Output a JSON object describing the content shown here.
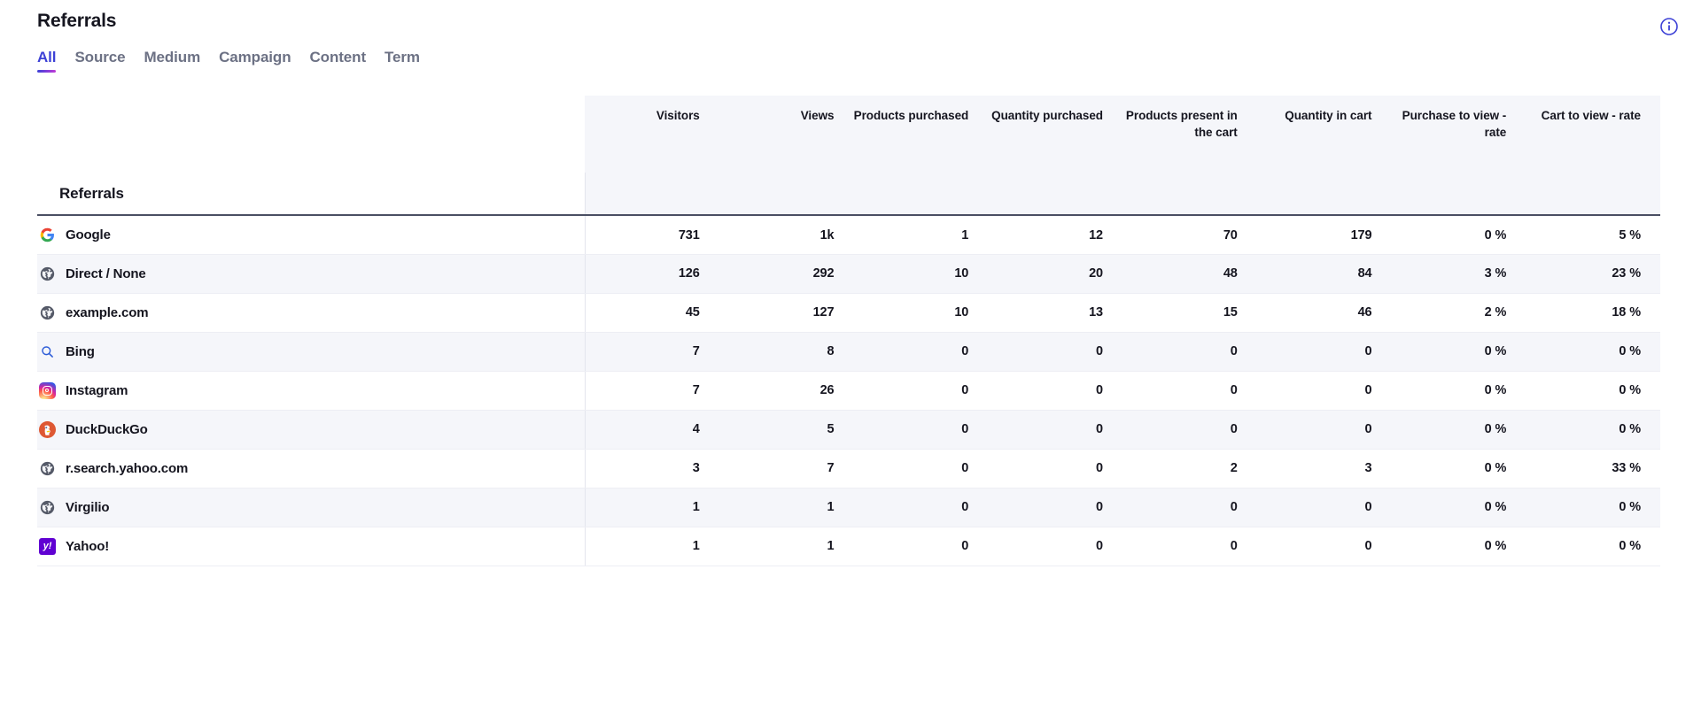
{
  "header": {
    "title": "Referrals",
    "info_icon": "info-circle-icon"
  },
  "tabs": [
    {
      "label": "All",
      "active": true
    },
    {
      "label": "Source",
      "active": false
    },
    {
      "label": "Medium",
      "active": false
    },
    {
      "label": "Campaign",
      "active": false
    },
    {
      "label": "Content",
      "active": false
    },
    {
      "label": "Term",
      "active": false
    }
  ],
  "table": {
    "label_column_header": "",
    "columns": [
      "Visitors",
      "Views",
      "Products purchased",
      "Quantity purchased",
      "Products present in the cart",
      "Quantity in cart",
      "Purchase to view - rate",
      "Cart to view - rate"
    ],
    "group_label": "Referrals",
    "rows": [
      {
        "icon": "google-icon",
        "label": "Google",
        "values": [
          "731",
          "1k",
          "1",
          "12",
          "70",
          "179",
          "0 %",
          "5 %"
        ]
      },
      {
        "icon": "globe-icon",
        "label": "Direct / None",
        "values": [
          "126",
          "292",
          "10",
          "20",
          "48",
          "84",
          "3 %",
          "23 %"
        ]
      },
      {
        "icon": "globe-icon",
        "label": "example.com",
        "values": [
          "45",
          "127",
          "10",
          "13",
          "15",
          "46",
          "2 %",
          "18 %"
        ]
      },
      {
        "icon": "search-icon",
        "label": "Bing",
        "values": [
          "7",
          "8",
          "0",
          "0",
          "0",
          "0",
          "0 %",
          "0 %"
        ]
      },
      {
        "icon": "instagram-icon",
        "label": "Instagram",
        "values": [
          "7",
          "26",
          "0",
          "0",
          "0",
          "0",
          "0 %",
          "0 %"
        ]
      },
      {
        "icon": "duckduckgo-icon",
        "label": "DuckDuckGo",
        "values": [
          "4",
          "5",
          "0",
          "0",
          "0",
          "0",
          "0 %",
          "0 %"
        ]
      },
      {
        "icon": "globe-icon",
        "label": "r.search.yahoo.com",
        "values": [
          "3",
          "7",
          "0",
          "0",
          "2",
          "3",
          "0 %",
          "33 %"
        ]
      },
      {
        "icon": "globe-icon",
        "label": "Virgilio",
        "values": [
          "1",
          "1",
          "0",
          "0",
          "0",
          "0",
          "0 %",
          "0 %"
        ]
      },
      {
        "icon": "yahoo-icon",
        "label": "Yahoo!",
        "values": [
          "1",
          "1",
          "0",
          "0",
          "0",
          "0",
          "0 %",
          "0 %"
        ]
      }
    ]
  },
  "colors": {
    "accent": "#3d41d6",
    "accent_gradient_end": "#c23bd4",
    "header_bg": "#f5f6fa",
    "row_alt_bg": "#f5f6fa",
    "text": "#15151f",
    "muted_text": "#6c7184"
  }
}
